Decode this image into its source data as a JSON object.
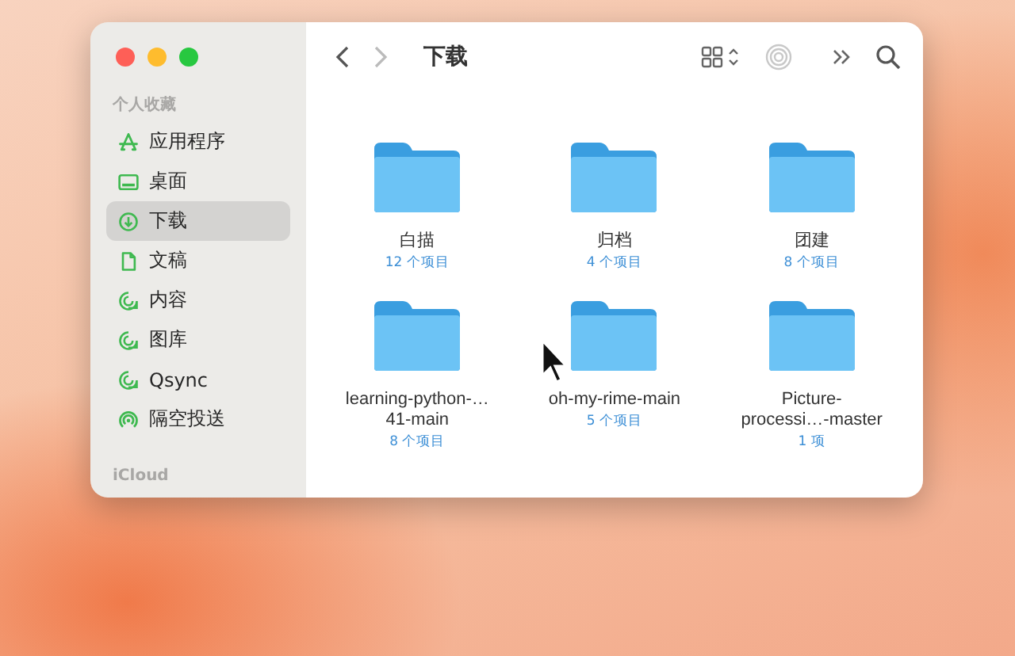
{
  "window": {
    "title": "下载"
  },
  "sidebar": {
    "sections": [
      {
        "title": "个人收藏",
        "items": [
          {
            "label": "应用程序",
            "kind": "apps",
            "selected": false
          },
          {
            "label": "桌面",
            "kind": "desktop",
            "selected": false
          },
          {
            "label": "下载",
            "kind": "download",
            "selected": true
          },
          {
            "label": "文稿",
            "kind": "document",
            "selected": false
          },
          {
            "label": "内容",
            "kind": "sync",
            "selected": false
          },
          {
            "label": "图库",
            "kind": "sync",
            "selected": false
          },
          {
            "label": "Qsync",
            "kind": "sync",
            "selected": false
          },
          {
            "label": "隔空投送",
            "kind": "airdrop",
            "selected": false
          }
        ]
      },
      {
        "title": "iCloud"
      }
    ]
  },
  "folders": [
    {
      "name": "白描",
      "count": "12 个项目"
    },
    {
      "name": "归档",
      "count": "4 个项目"
    },
    {
      "name": "团建",
      "count": "8 个项目"
    },
    {
      "name": "learning-python-…41-main",
      "count": "8 个项目"
    },
    {
      "name": "oh-my-rime-main",
      "count": "5 个项目"
    },
    {
      "name": "Picture-processi…-master",
      "count": "1 项"
    }
  ]
}
